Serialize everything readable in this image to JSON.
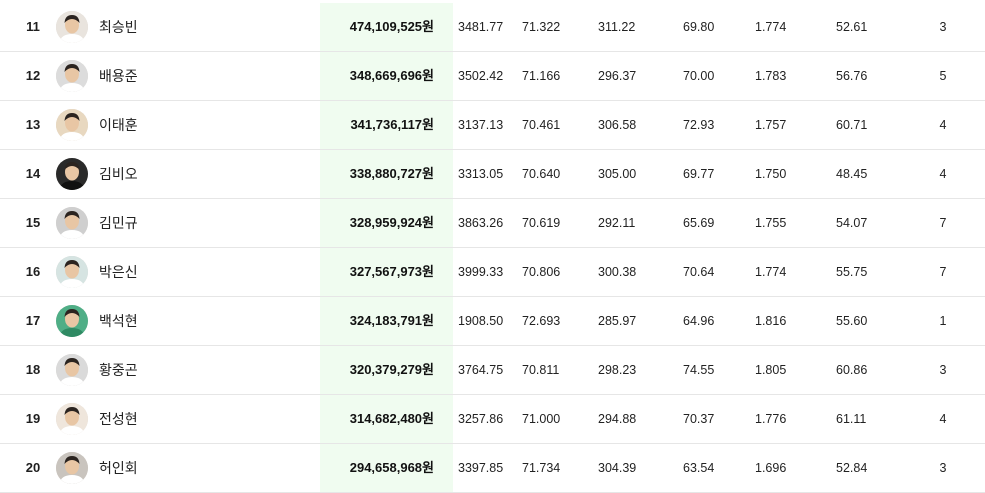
{
  "table": {
    "rows": [
      {
        "rank": "11",
        "name": "최승빈",
        "prize": "474,109,525원",
        "stat1": "3481.77",
        "stat2": "71.322",
        "stat3": "311.22",
        "stat4": "69.80",
        "stat5": "1.774",
        "stat6": "52.61",
        "stat7": "3",
        "avatar_color": "#e9e4de"
      },
      {
        "rank": "12",
        "name": "배용준",
        "prize": "348,669,696원",
        "stat1": "3502.42",
        "stat2": "71.166",
        "stat3": "296.37",
        "stat4": "70.00",
        "stat5": "1.783",
        "stat6": "56.76",
        "stat7": "5",
        "avatar_color": "#dcdcdc"
      },
      {
        "rank": "13",
        "name": "이태훈",
        "prize": "341,736,117원",
        "stat1": "3137.13",
        "stat2": "70.461",
        "stat3": "306.58",
        "stat4": "72.93",
        "stat5": "1.757",
        "stat6": "60.71",
        "stat7": "4",
        "avatar_color": "#e8d8c0"
      },
      {
        "rank": "14",
        "name": "김비오",
        "prize": "338,880,727원",
        "stat1": "3313.05",
        "stat2": "70.640",
        "stat3": "305.00",
        "stat4": "69.77",
        "stat5": "1.750",
        "stat6": "48.45",
        "stat7": "4",
        "avatar_color": "#2a2a2a"
      },
      {
        "rank": "15",
        "name": "김민규",
        "prize": "328,959,924원",
        "stat1": "3863.26",
        "stat2": "70.619",
        "stat3": "292.11",
        "stat4": "65.69",
        "stat5": "1.755",
        "stat6": "54.07",
        "stat7": "7",
        "avatar_color": "#cfcfcf"
      },
      {
        "rank": "16",
        "name": "박은신",
        "prize": "327,567,973원",
        "stat1": "3999.33",
        "stat2": "70.806",
        "stat3": "300.38",
        "stat4": "70.64",
        "stat5": "1.774",
        "stat6": "55.75",
        "stat7": "7",
        "avatar_color": "#d6e4e2"
      },
      {
        "rank": "17",
        "name": "백석현",
        "prize": "324,183,791원",
        "stat1": "1908.50",
        "stat2": "72.693",
        "stat3": "285.97",
        "stat4": "64.96",
        "stat5": "1.816",
        "stat6": "55.60",
        "stat7": "1",
        "avatar_color": "#4fae86"
      },
      {
        "rank": "18",
        "name": "황중곤",
        "prize": "320,379,279원",
        "stat1": "3764.75",
        "stat2": "70.811",
        "stat3": "298.23",
        "stat4": "74.55",
        "stat5": "1.805",
        "stat6": "60.86",
        "stat7": "3",
        "avatar_color": "#dadada"
      },
      {
        "rank": "19",
        "name": "전성현",
        "prize": "314,682,480원",
        "stat1": "3257.86",
        "stat2": "71.000",
        "stat3": "294.88",
        "stat4": "70.37",
        "stat5": "1.776",
        "stat6": "61.11",
        "stat7": "4",
        "avatar_color": "#efe6dc"
      },
      {
        "rank": "20",
        "name": "허인회",
        "prize": "294,658,968원",
        "stat1": "3397.85",
        "stat2": "71.734",
        "stat3": "304.39",
        "stat4": "63.54",
        "stat5": "1.696",
        "stat6": "52.84",
        "stat7": "3",
        "avatar_color": "#c9c4be"
      }
    ]
  }
}
